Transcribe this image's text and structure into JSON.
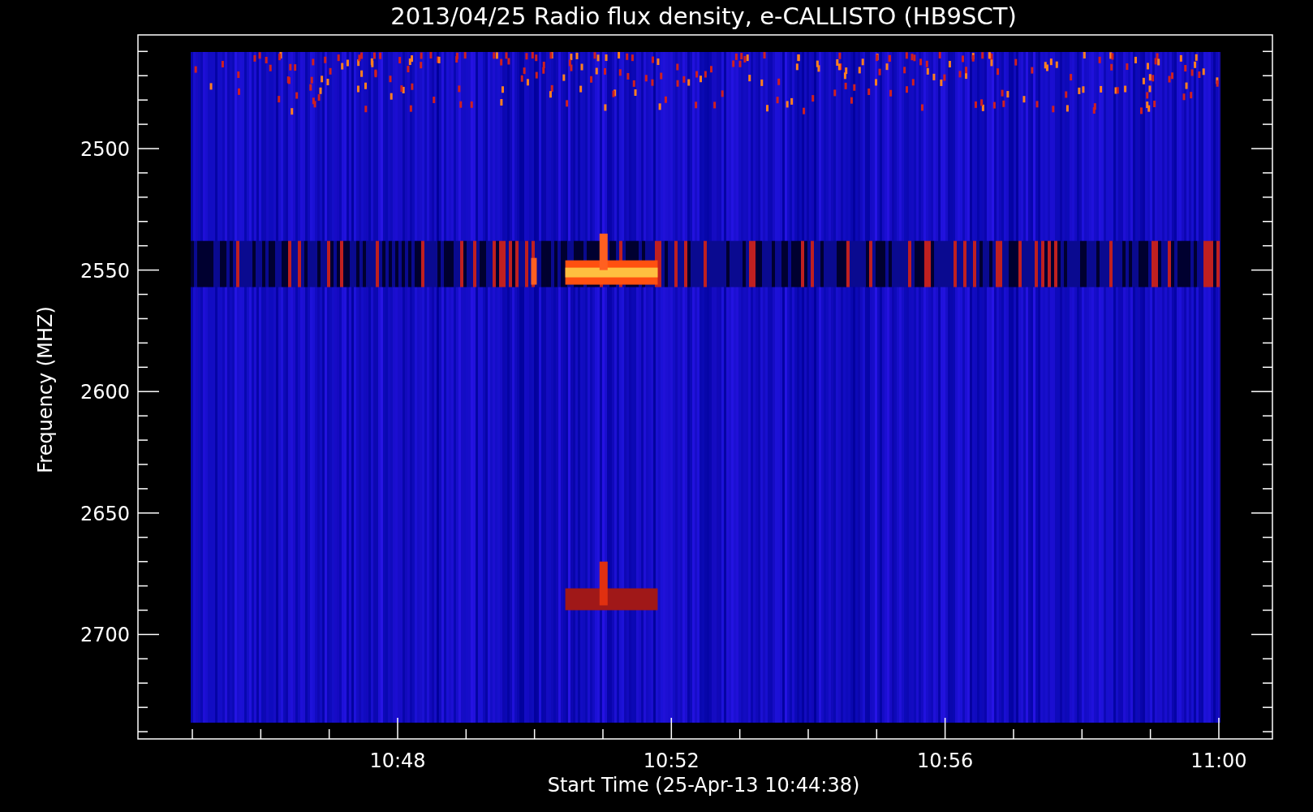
{
  "title": "2013/04/25  Radio flux density, e-CALLISTO (HB9SCT)",
  "ylabel": "Frequency (MHZ)",
  "xlabel": "Start Time (25-Apr-13 10:44:38)",
  "yticks": [
    {
      "label": "2500"
    },
    {
      "label": "2550"
    },
    {
      "label": "2600"
    },
    {
      "label": "2650"
    },
    {
      "label": "2700"
    }
  ],
  "xticks": [
    {
      "label": "10:48"
    },
    {
      "label": "10:52"
    },
    {
      "label": "10:56"
    },
    {
      "label": "11:00"
    }
  ]
}
